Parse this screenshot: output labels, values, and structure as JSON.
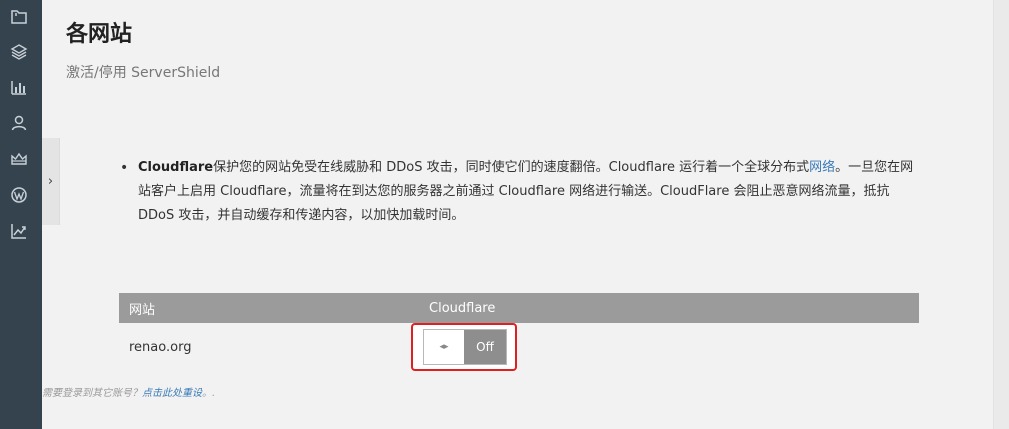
{
  "sidebar": {
    "icons": [
      "folder-icon",
      "layers-icon",
      "bar-chart-icon",
      "user-icon",
      "crown-icon",
      "wordpress-icon",
      "trend-chart-icon"
    ]
  },
  "collapse_tab": {
    "glyph": "›"
  },
  "page": {
    "title": "各网站",
    "subtitle": "激活/停用 ServerShield"
  },
  "description": {
    "bullet": "•",
    "brand": "Cloudflare",
    "text_1": "保护您的网站免受在线威胁和 DDoS 攻击，同时使它们的速度翻倍。Cloudflare 运行着一个全球分布式",
    "link": "网络",
    "text_2": "。一旦您在网站客户上启用 Cloudflare，流量将在到达您的服务器之前通过 Cloudflare 网络进行输送。CloudFlare 会阻止恶意网络流量，抵抗 DDoS 攻击，并自动缓存和传递内容，以加快加载时间。"
  },
  "table": {
    "headers": {
      "site": "网站",
      "cloudflare": "Cloudflare"
    },
    "rows": [
      {
        "site": "renao.org",
        "toggle_knob": "◂▸",
        "toggle_state": "Off"
      }
    ]
  },
  "footer": {
    "text_before": "需要登录到其它账号？",
    "link": "点击此处重设",
    "text_after": "。."
  },
  "colors": {
    "sidebar_bg": "#35434f",
    "header_bg": "#9b9b9b",
    "link": "#3a7ab8",
    "highlight_border": "#e02020",
    "toggle_off_bg": "#8e8e8e"
  }
}
